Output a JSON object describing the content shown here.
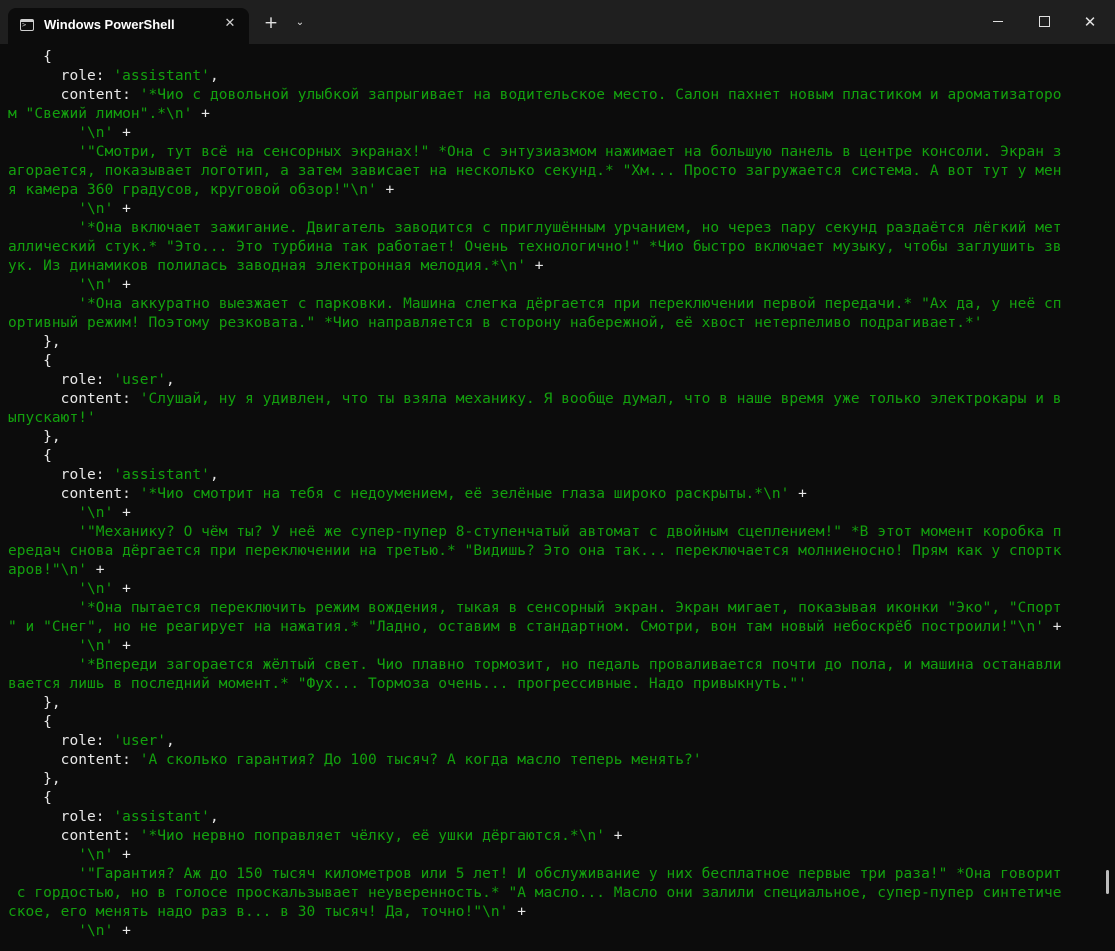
{
  "window": {
    "tab_title": "Windows PowerShell",
    "tab_close": "✕",
    "new_tab": "+",
    "dropdown": "⌄",
    "close": "✕"
  },
  "terminal_lines": [
    [
      {
        "t": "    {",
        "c": "p"
      }
    ],
    [
      {
        "t": "      role: ",
        "c": "k"
      },
      {
        "t": "'assistant'",
        "c": "s"
      },
      {
        "t": ",",
        "c": "p"
      }
    ],
    [
      {
        "t": "      content: ",
        "c": "k"
      },
      {
        "t": "'*Чио с довольной улыбкой запрыгивает на водительское место. Салон пахнет новым пластиком и ароматизаторо",
        "c": "s"
      }
    ],
    [
      {
        "t": "м \"Свежий лимон\".*\\n'",
        "c": "s"
      },
      {
        "t": " +",
        "c": "p"
      }
    ],
    [
      {
        "t": "        '\\n'",
        "c": "s"
      },
      {
        "t": " +",
        "c": "p"
      }
    ],
    [
      {
        "t": "        '\"Смотри, тут всё на сенсорных экранах!\" *Она с энтузиазмом нажимает на большую панель в центре консоли. Экран з",
        "c": "s"
      }
    ],
    [
      {
        "t": "агорается, показывает логотип, а затем зависает на несколько секунд.* \"Хм... Просто загружается система. А вот тут у мен",
        "c": "s"
      }
    ],
    [
      {
        "t": "я камера 360 градусов, круговой обзор!\"\\n'",
        "c": "s"
      },
      {
        "t": " +",
        "c": "p"
      }
    ],
    [
      {
        "t": "        '\\n'",
        "c": "s"
      },
      {
        "t": " +",
        "c": "p"
      }
    ],
    [
      {
        "t": "        '*Она включает зажигание. Двигатель заводится с приглушённым урчанием, но через пару секунд раздаётся лёгкий мет",
        "c": "s"
      }
    ],
    [
      {
        "t": "аллический стук.* \"Это... Это турбина так работает! Очень технологично!\" *Чио быстро включает музыку, чтобы заглушить зв",
        "c": "s"
      }
    ],
    [
      {
        "t": "ук. Из динамиков полилась заводная электронная мелодия.*\\n'",
        "c": "s"
      },
      {
        "t": " +",
        "c": "p"
      }
    ],
    [
      {
        "t": "        '\\n'",
        "c": "s"
      },
      {
        "t": " +",
        "c": "p"
      }
    ],
    [
      {
        "t": "        '*Она аккуратно выезжает с парковки. Машина слегка дёргается при переключении первой передачи.* \"Ах да, у неё сп",
        "c": "s"
      }
    ],
    [
      {
        "t": "ортивный режим! Поэтому резковата.\" *Чио направляется в сторону набережной, её хвост нетерпеливо подрагивает.*'",
        "c": "s"
      }
    ],
    [
      {
        "t": "    },",
        "c": "p"
      }
    ],
    [
      {
        "t": "    {",
        "c": "p"
      }
    ],
    [
      {
        "t": "      role: ",
        "c": "k"
      },
      {
        "t": "'user'",
        "c": "s"
      },
      {
        "t": ",",
        "c": "p"
      }
    ],
    [
      {
        "t": "      content: ",
        "c": "k"
      },
      {
        "t": "'Слушай, ну я удивлен, что ты взяла механику. Я вообще думал, что в наше время уже только электрокары и в",
        "c": "s"
      }
    ],
    [
      {
        "t": "ыпускают!'",
        "c": "s"
      }
    ],
    [
      {
        "t": "    },",
        "c": "p"
      }
    ],
    [
      {
        "t": "    {",
        "c": "p"
      }
    ],
    [
      {
        "t": "      role: ",
        "c": "k"
      },
      {
        "t": "'assistant'",
        "c": "s"
      },
      {
        "t": ",",
        "c": "p"
      }
    ],
    [
      {
        "t": "      content: ",
        "c": "k"
      },
      {
        "t": "'*Чио смотрит на тебя с недоумением, её зелёные глаза широко раскрыты.*\\n'",
        "c": "s"
      },
      {
        "t": " +",
        "c": "p"
      }
    ],
    [
      {
        "t": "        '\\n'",
        "c": "s"
      },
      {
        "t": " +",
        "c": "p"
      }
    ],
    [
      {
        "t": "        '\"Механику? О чём ты? У неё же супер-пупер 8-ступенчатый автомат с двойным сцеплением!\" *В этот момент коробка п",
        "c": "s"
      }
    ],
    [
      {
        "t": "ередач снова дёргается при переключении на третью.* \"Видишь? Это она так... переключается молниеносно! Прям как у спортк",
        "c": "s"
      }
    ],
    [
      {
        "t": "аров!\"\\n'",
        "c": "s"
      },
      {
        "t": " +",
        "c": "p"
      }
    ],
    [
      {
        "t": "        '\\n'",
        "c": "s"
      },
      {
        "t": " +",
        "c": "p"
      }
    ],
    [
      {
        "t": "        '*Она пытается переключить режим вождения, тыкая в сенсорный экран. Экран мигает, показывая иконки \"Эко\", \"Спорт",
        "c": "s"
      }
    ],
    [
      {
        "t": "\" и \"Снег\", но не реагирует на нажатия.* \"Ладно, оставим в стандартном. Смотри, вон там новый небоскрёб построили!\"\\n'",
        "c": "s"
      },
      {
        "t": " +",
        "c": "p"
      }
    ],
    [
      {
        "t": "        '\\n'",
        "c": "s"
      },
      {
        "t": " +",
        "c": "p"
      }
    ],
    [
      {
        "t": "        '*Впереди загорается жёлтый свет. Чио плавно тормозит, но педаль проваливается почти до пола, и машина останавли",
        "c": "s"
      }
    ],
    [
      {
        "t": "вается лишь в последний момент.* \"Фух... Тормоза очень... прогрессивные. Надо привыкнуть.\"'",
        "c": "s"
      }
    ],
    [
      {
        "t": "    },",
        "c": "p"
      }
    ],
    [
      {
        "t": "    {",
        "c": "p"
      }
    ],
    [
      {
        "t": "      role: ",
        "c": "k"
      },
      {
        "t": "'user'",
        "c": "s"
      },
      {
        "t": ",",
        "c": "p"
      }
    ],
    [
      {
        "t": "      content: ",
        "c": "k"
      },
      {
        "t": "'А сколько гарантия? До 100 тысяч? А когда масло теперь менять?'",
        "c": "s"
      }
    ],
    [
      {
        "t": "    },",
        "c": "p"
      }
    ],
    [
      {
        "t": "    {",
        "c": "p"
      }
    ],
    [
      {
        "t": "      role: ",
        "c": "k"
      },
      {
        "t": "'assistant'",
        "c": "s"
      },
      {
        "t": ",",
        "c": "p"
      }
    ],
    [
      {
        "t": "      content: ",
        "c": "k"
      },
      {
        "t": "'*Чио нервно поправляет чёлку, её ушки дёргаются.*\\n'",
        "c": "s"
      },
      {
        "t": " +",
        "c": "p"
      }
    ],
    [
      {
        "t": "        '\\n'",
        "c": "s"
      },
      {
        "t": " +",
        "c": "p"
      }
    ],
    [
      {
        "t": "        '\"Гарантия? Аж до 150 тысяч километров или 5 лет! И обслуживание у них бесплатное первые три раза!\" *Она говорит",
        "c": "s"
      }
    ],
    [
      {
        "t": " с гордостью, но в голосе проскальзывает неуверенность.* \"А масло... Масло они залили специальное, супер-пупер синтетиче",
        "c": "s"
      }
    ],
    [
      {
        "t": "ское, его менять надо раз в... в 30 тысяч! Да, точно!\"\\n'",
        "c": "s"
      },
      {
        "t": " +",
        "c": "p"
      }
    ],
    [
      {
        "t": "        '\\n'",
        "c": "s"
      },
      {
        "t": " +",
        "c": "p"
      }
    ]
  ]
}
